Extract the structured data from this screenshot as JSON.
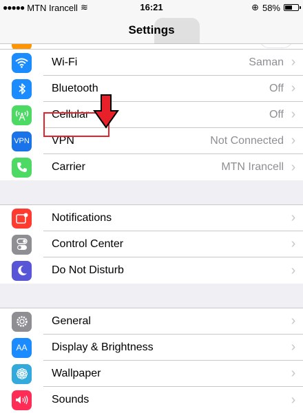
{
  "status_bar": {
    "signal_dots": "●●●●●",
    "carrier": "MTN Irancell",
    "wifi_symbol": "≋",
    "time": "16:21",
    "alarm_symbol": "⊕",
    "battery_percent": "58%",
    "battery_level": 0.58
  },
  "nav": {
    "title": "Settings"
  },
  "groups": [
    {
      "rows": [
        {
          "label": "Wi-Fi",
          "detail": "Saman",
          "icon": "wifi-icon",
          "color": "#1a8cff"
        },
        {
          "label": "Bluetooth",
          "detail": "Off",
          "icon": "bluetooth-icon",
          "color": "#1a8cff"
        },
        {
          "label": "Cellular",
          "detail": "Off",
          "icon": "cellular-icon",
          "color": "#4cd964"
        },
        {
          "label": "VPN",
          "detail": "Not Connected",
          "icon": "vpn-icon",
          "color": "#1a73e8"
        },
        {
          "label": "Carrier",
          "detail": "MTN Irancell",
          "icon": "phone-icon",
          "color": "#4cd964"
        }
      ]
    },
    {
      "rows": [
        {
          "label": "Notifications",
          "detail": "",
          "icon": "notifications-icon",
          "color": "#ff3b30"
        },
        {
          "label": "Control Center",
          "detail": "",
          "icon": "control-center-icon",
          "color": "#8e8e93"
        },
        {
          "label": "Do Not Disturb",
          "detail": "",
          "icon": "moon-icon",
          "color": "#5856d6"
        }
      ]
    },
    {
      "rows": [
        {
          "label": "General",
          "detail": "",
          "icon": "gear-icon",
          "color": "#8e8e93"
        },
        {
          "label": "Display & Brightness",
          "detail": "",
          "icon": "display-icon",
          "color": "#1a8cff"
        },
        {
          "label": "Wallpaper",
          "detail": "",
          "icon": "wallpaper-icon",
          "color": "#34aadc"
        },
        {
          "label": "Sounds",
          "detail": "",
          "icon": "sounds-icon",
          "color": "#ff2d55"
        }
      ]
    }
  ],
  "icon_glyphs": {
    "vpn": "VPN",
    "display": "AA"
  },
  "chevron": "›",
  "annotation_color": "#e8202a"
}
